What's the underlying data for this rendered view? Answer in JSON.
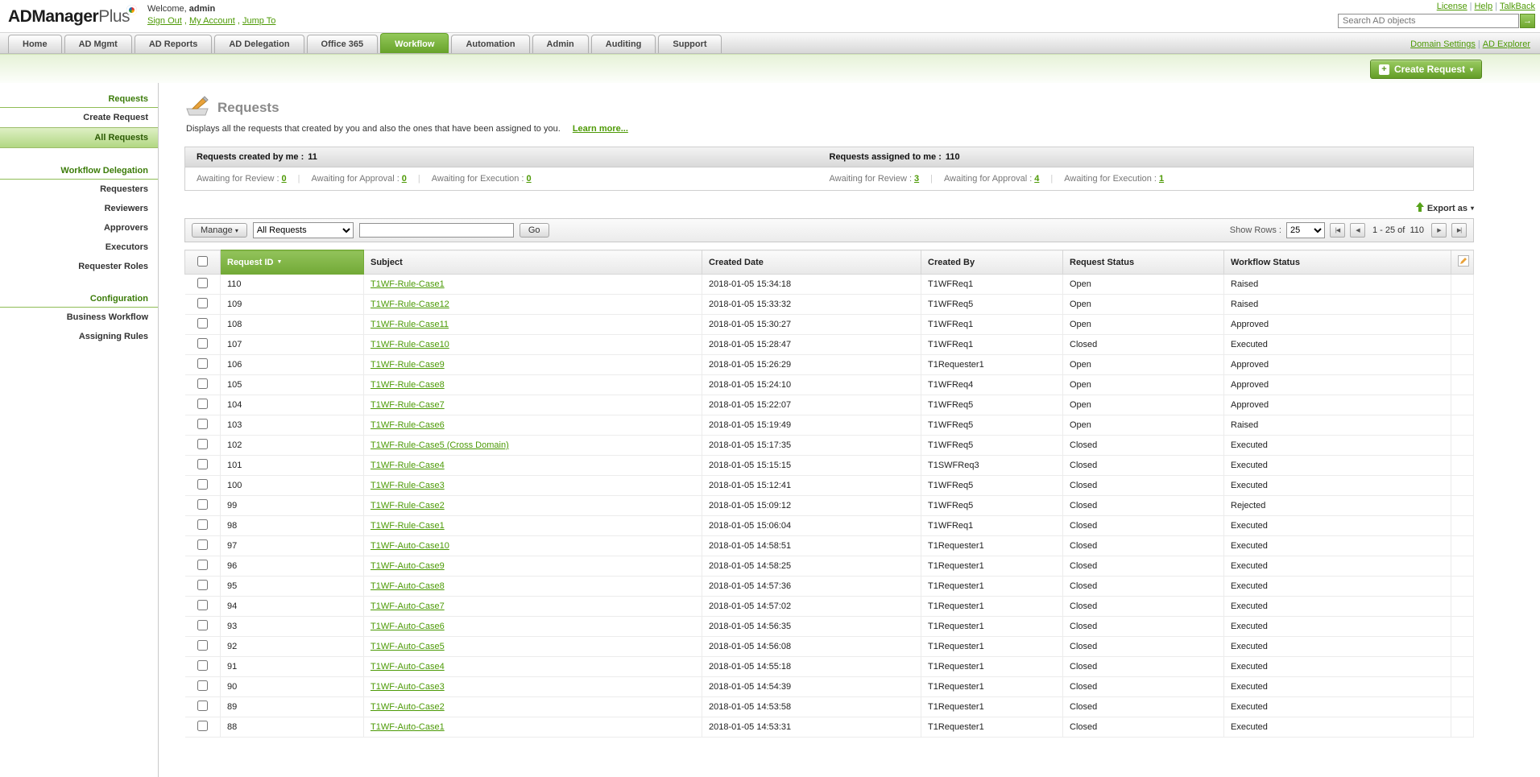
{
  "brand": {
    "name_bold": "ADManager",
    "name_light": "Plus"
  },
  "header": {
    "welcome_prefix": "Welcome,",
    "username": "admin",
    "account_links": [
      "Sign Out",
      "My Account",
      "Jump To"
    ],
    "utility_links": [
      "License",
      "Help",
      "TalkBack"
    ],
    "search_placeholder": "Search AD objects"
  },
  "tabs": [
    {
      "label": "Home",
      "active": false
    },
    {
      "label": "AD Mgmt",
      "active": false
    },
    {
      "label": "AD Reports",
      "active": false
    },
    {
      "label": "AD Delegation",
      "active": false
    },
    {
      "label": "Office 365",
      "active": false
    },
    {
      "label": "Workflow",
      "active": true
    },
    {
      "label": "Automation",
      "active": false
    },
    {
      "label": "Admin",
      "active": false
    },
    {
      "label": "Auditing",
      "active": false
    },
    {
      "label": "Support",
      "active": false
    }
  ],
  "subnav_links": [
    "Domain Settings",
    "AD Explorer"
  ],
  "create_request": {
    "label": "Create Request"
  },
  "sidebar": {
    "selected": "All Requests",
    "sections": [
      {
        "header": "Requests",
        "items": [
          "Create Request",
          "All Requests"
        ]
      },
      {
        "header": "Workflow Delegation",
        "items": [
          "Requesters",
          "Reviewers",
          "Approvers",
          "Executors",
          "Requester Roles"
        ]
      },
      {
        "header": "Configuration",
        "items": [
          "Business Workflow",
          "Assigning Rules"
        ]
      }
    ]
  },
  "page": {
    "title": "Requests",
    "description": "Displays all the requests that created by you and also the ones that have been assigned to you.",
    "learn_more": "Learn more...",
    "summary": {
      "created": {
        "label": "Requests created by me :",
        "count": "11",
        "stats": [
          {
            "label": "Awaiting for Review :",
            "value": "0"
          },
          {
            "label": "Awaiting for Approval :",
            "value": "0"
          },
          {
            "label": "Awaiting for Execution :",
            "value": "0"
          }
        ]
      },
      "assigned": {
        "label": "Requests assigned to me :",
        "count": "110",
        "stats": [
          {
            "label": "Awaiting for Review :",
            "value": "3"
          },
          {
            "label": "Awaiting for Approval :",
            "value": "4"
          },
          {
            "label": "Awaiting for Execution :",
            "value": "1"
          }
        ]
      }
    },
    "export_label": "Export as",
    "toolbar": {
      "manage_label": "Manage",
      "filter_value": "All Requests",
      "search_value": "",
      "go_label": "Go",
      "show_rows_label": "Show Rows :",
      "show_rows_value": "25",
      "range_text": "1 - 25 of  110"
    },
    "table": {
      "headers": {
        "request_id": "Request ID",
        "subject": "Subject",
        "created_date": "Created Date",
        "created_by": "Created By",
        "request_status": "Request Status",
        "workflow_status": "Workflow Status"
      },
      "rows": [
        {
          "id": "110",
          "subject": "T1WF-Rule-Case1",
          "created_date": "2018-01-05 15:34:18",
          "created_by": "T1WFReq1",
          "request_status": "Open",
          "workflow_status": "Raised"
        },
        {
          "id": "109",
          "subject": "T1WF-Rule-Case12",
          "created_date": "2018-01-05 15:33:32",
          "created_by": "T1WFReq5",
          "request_status": "Open",
          "workflow_status": "Raised"
        },
        {
          "id": "108",
          "subject": "T1WF-Rule-Case11",
          "created_date": "2018-01-05 15:30:27",
          "created_by": "T1WFReq1",
          "request_status": "Open",
          "workflow_status": "Approved"
        },
        {
          "id": "107",
          "subject": "T1WF-Rule-Case10",
          "created_date": "2018-01-05 15:28:47",
          "created_by": "T1WFReq1",
          "request_status": "Closed",
          "workflow_status": "Executed"
        },
        {
          "id": "106",
          "subject": "T1WF-Rule-Case9",
          "created_date": "2018-01-05 15:26:29",
          "created_by": "T1Requester1",
          "request_status": "Open",
          "workflow_status": "Approved"
        },
        {
          "id": "105",
          "subject": "T1WF-Rule-Case8",
          "created_date": "2018-01-05 15:24:10",
          "created_by": "T1WFReq4",
          "request_status": "Open",
          "workflow_status": "Approved"
        },
        {
          "id": "104",
          "subject": "T1WF-Rule-Case7",
          "created_date": "2018-01-05 15:22:07",
          "created_by": "T1WFReq5",
          "request_status": "Open",
          "workflow_status": "Approved"
        },
        {
          "id": "103",
          "subject": "T1WF-Rule-Case6",
          "created_date": "2018-01-05 15:19:49",
          "created_by": "T1WFReq5",
          "request_status": "Open",
          "workflow_status": "Raised"
        },
        {
          "id": "102",
          "subject": "T1WF-Rule-Case5 (Cross Domain)",
          "created_date": "2018-01-05 15:17:35",
          "created_by": "T1WFReq5",
          "request_status": "Closed",
          "workflow_status": "Executed"
        },
        {
          "id": "101",
          "subject": "T1WF-Rule-Case4",
          "created_date": "2018-01-05 15:15:15",
          "created_by": "T1SWFReq3",
          "request_status": "Closed",
          "workflow_status": "Executed"
        },
        {
          "id": "100",
          "subject": "T1WF-Rule-Case3",
          "created_date": "2018-01-05 15:12:41",
          "created_by": "T1WFReq5",
          "request_status": "Closed",
          "workflow_status": "Executed"
        },
        {
          "id": "99",
          "subject": "T1WF-Rule-Case2",
          "created_date": "2018-01-05 15:09:12",
          "created_by": "T1WFReq5",
          "request_status": "Closed",
          "workflow_status": "Rejected"
        },
        {
          "id": "98",
          "subject": "T1WF-Rule-Case1",
          "created_date": "2018-01-05 15:06:04",
          "created_by": "T1WFReq1",
          "request_status": "Closed",
          "workflow_status": "Executed"
        },
        {
          "id": "97",
          "subject": "T1WF-Auto-Case10",
          "created_date": "2018-01-05 14:58:51",
          "created_by": "T1Requester1",
          "request_status": "Closed",
          "workflow_status": "Executed"
        },
        {
          "id": "96",
          "subject": "T1WF-Auto-Case9",
          "created_date": "2018-01-05 14:58:25",
          "created_by": "T1Requester1",
          "request_status": "Closed",
          "workflow_status": "Executed"
        },
        {
          "id": "95",
          "subject": "T1WF-Auto-Case8",
          "created_date": "2018-01-05 14:57:36",
          "created_by": "T1Requester1",
          "request_status": "Closed",
          "workflow_status": "Executed"
        },
        {
          "id": "94",
          "subject": "T1WF-Auto-Case7",
          "created_date": "2018-01-05 14:57:02",
          "created_by": "T1Requester1",
          "request_status": "Closed",
          "workflow_status": "Executed"
        },
        {
          "id": "93",
          "subject": "T1WF-Auto-Case6",
          "created_date": "2018-01-05 14:56:35",
          "created_by": "T1Requester1",
          "request_status": "Closed",
          "workflow_status": "Executed"
        },
        {
          "id": "92",
          "subject": "T1WF-Auto-Case5",
          "created_date": "2018-01-05 14:56:08",
          "created_by": "T1Requester1",
          "request_status": "Closed",
          "workflow_status": "Executed"
        },
        {
          "id": "91",
          "subject": "T1WF-Auto-Case4",
          "created_date": "2018-01-05 14:55:18",
          "created_by": "T1Requester1",
          "request_status": "Closed",
          "workflow_status": "Executed"
        },
        {
          "id": "90",
          "subject": "T1WF-Auto-Case3",
          "created_date": "2018-01-05 14:54:39",
          "created_by": "T1Requester1",
          "request_status": "Closed",
          "workflow_status": "Executed"
        },
        {
          "id": "89",
          "subject": "T1WF-Auto-Case2",
          "created_date": "2018-01-05 14:53:58",
          "created_by": "T1Requester1",
          "request_status": "Closed",
          "workflow_status": "Executed"
        },
        {
          "id": "88",
          "subject": "T1WF-Auto-Case1",
          "created_date": "2018-01-05 14:53:31",
          "created_by": "T1Requester1",
          "request_status": "Closed",
          "workflow_status": "Executed"
        }
      ]
    }
  },
  "colors": {
    "accent_green": "#72a936",
    "link_green": "#4e9a06"
  }
}
